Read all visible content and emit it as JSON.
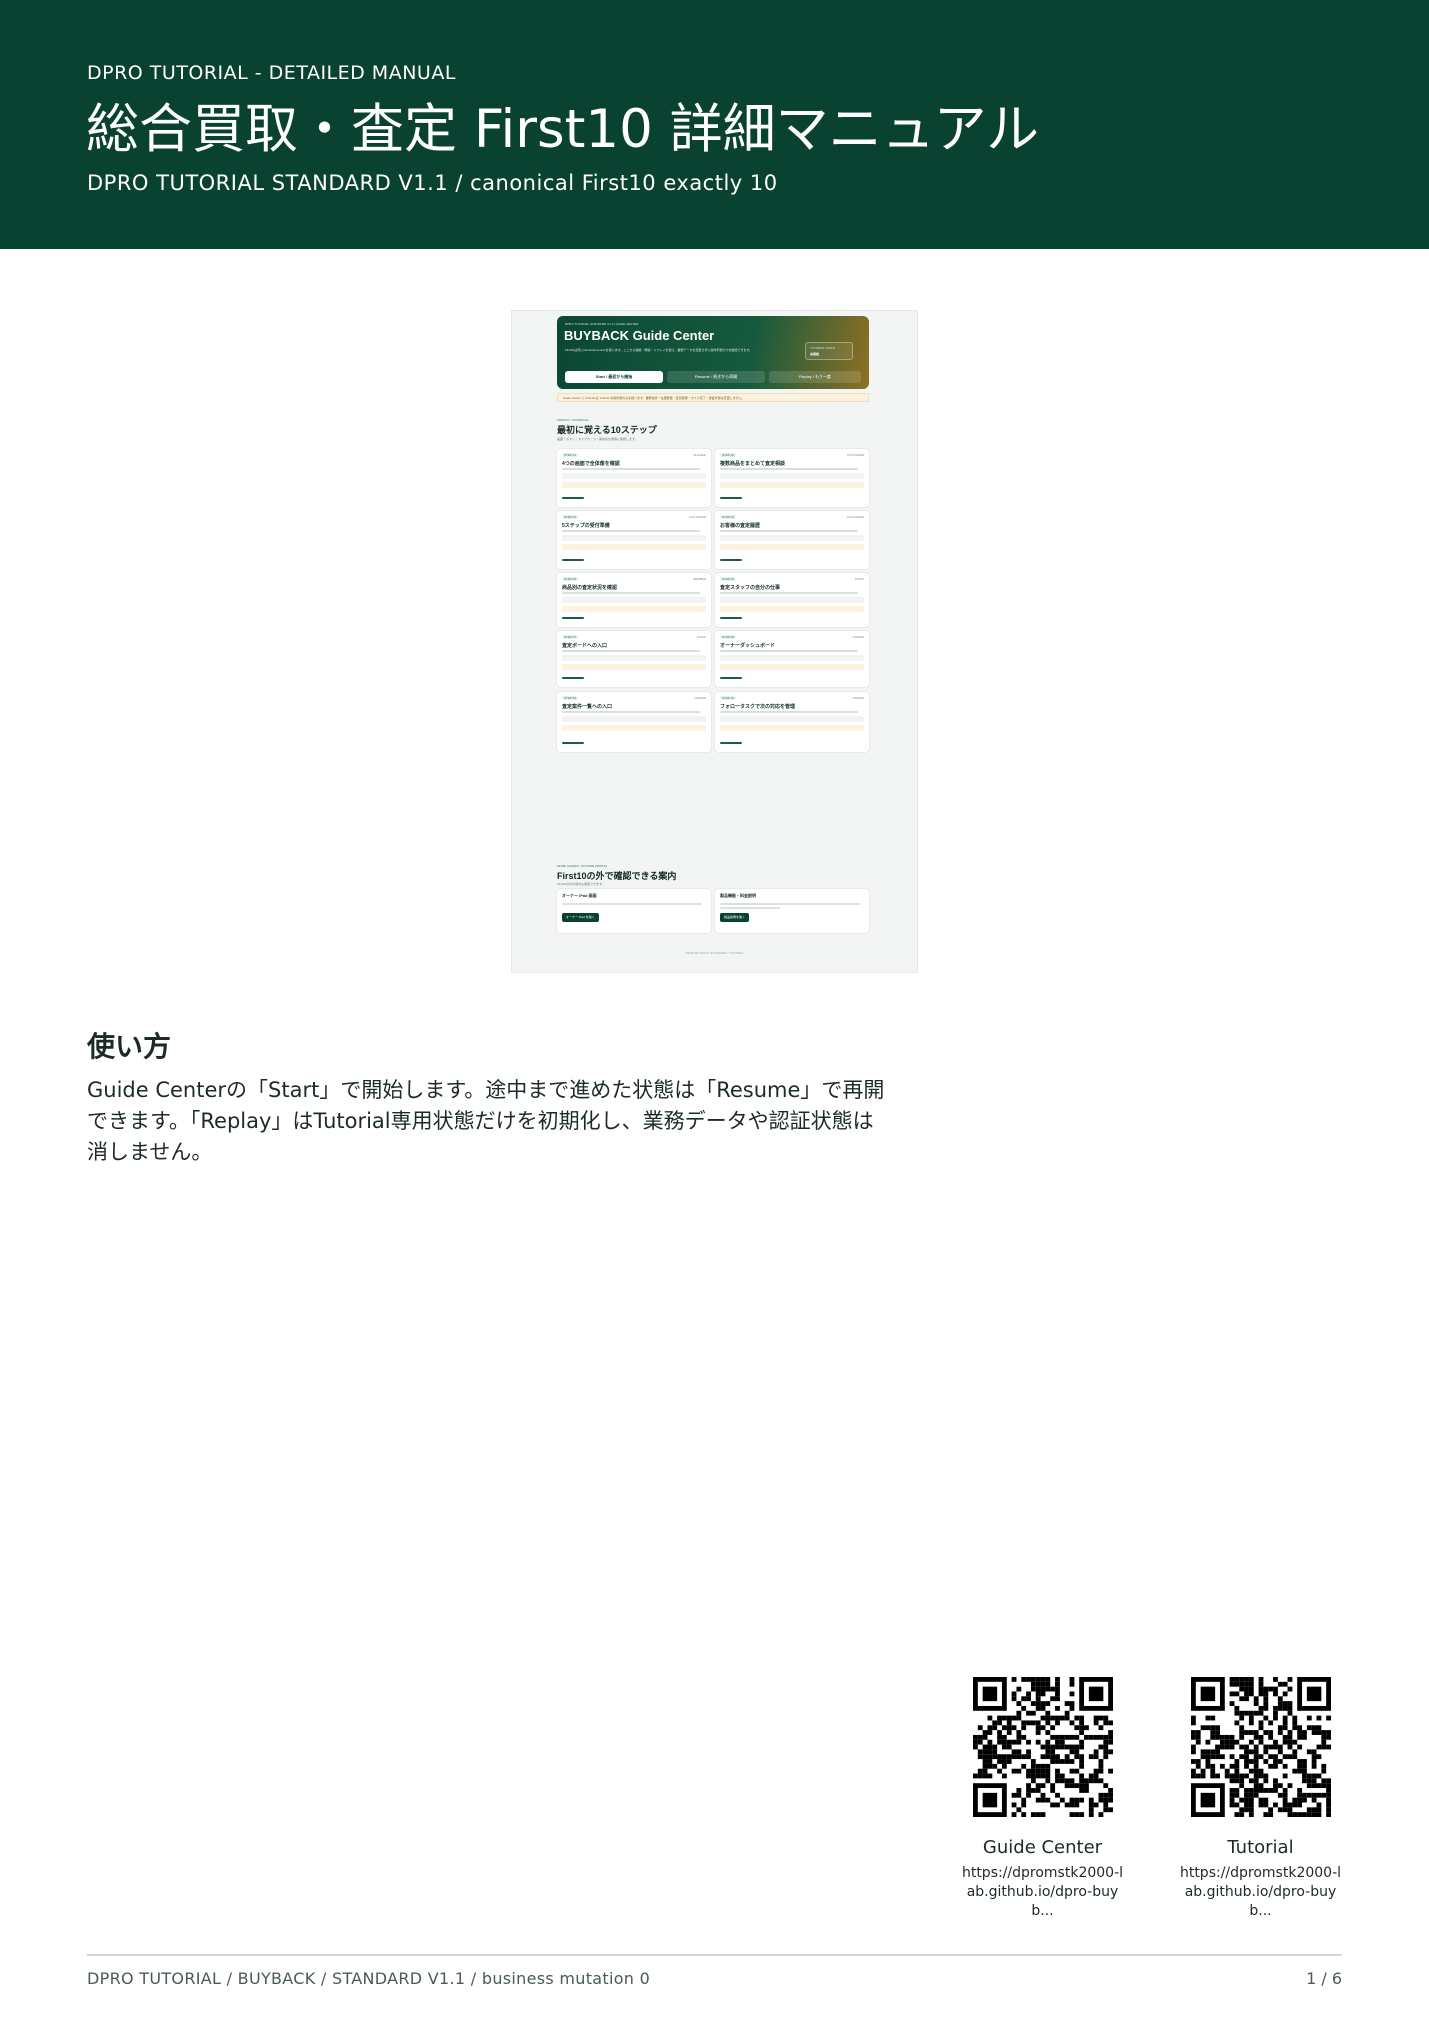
{
  "header": {
    "kicker": "DPRO TUTORIAL - DETAILED MANUAL",
    "title": "総合買取・査定 First10 詳細マニュアル",
    "subtitle": "DPRO TUTORIAL STANDARD V1.1 / canonical First10 exactly 10"
  },
  "screenshot": {
    "eyebrow": "DPRO TUTORIAL STANDARD V1.1 | GUIDE CENTER",
    "app_title": "BUYBACK Guide Center",
    "description": "First10は同じcanonical sourceを使います。ここから開始・再開・リプレイを選び、業務データを変更せずに操作手順だけを確認できます。",
    "status_label": "TUTORIAL STATE",
    "status_value": "未開始",
    "buttons": {
      "start": "Start / 最初から開始",
      "resume": "Resume / 続きから再開",
      "replay": "Replay / もう一度"
    },
    "notice": "Guide Center と First10 は Tutorial 専用状態のみを扱います。業務案件・在庫数量・査定結果・タスク完了・認証状態は変更しません。",
    "steps_eyebrow": "FIRST10 / CANONICAL",
    "steps_title": "最初に覚える10ステップ",
    "steps_sub": "画面・ボタン・タスクカード・異常系を順番に確認します。",
    "steps": [
      {
        "tag": "STEP 01",
        "role": "SHARED",
        "title": "4つの画面で全体像を確認"
      },
      {
        "tag": "STEP 02",
        "role": "CUSTOMER",
        "title": "複数商品をまとめて査定相談"
      },
      {
        "tag": "STEP 03",
        "role": "CUSTOMER",
        "title": "5ステップの受付準備"
      },
      {
        "tag": "STEP 04",
        "role": "CUSTOMER",
        "title": "お客様の査定履歴"
      },
      {
        "tag": "STEP 05",
        "role": "MEMBER",
        "title": "商品別の査定状況を確認"
      },
      {
        "tag": "STEP 06",
        "role": "STAFF",
        "title": "査定スタッフの自分の仕事"
      },
      {
        "tag": "STEP 07",
        "role": "STAFF",
        "title": "査定ボードへの入口"
      },
      {
        "tag": "STEP 08",
        "role": "OWNER",
        "title": "オーナーダッシュボード"
      },
      {
        "tag": "STEP 09",
        "role": "OWNER",
        "title": "査定案件一覧への入口"
      },
      {
        "tag": "STEP 10",
        "role": "OWNER",
        "title": "フォロータスクで次の対応を管理"
      }
    ],
    "extra_eyebrow": "MORE GUIDES / OUTSIDE FIRST10",
    "extra_title": "First10の外で確認できる案内",
    "extra_sub": "First10の外の案内も確認できます。",
    "extras": [
      {
        "title": "オーナー iPad 画面",
        "button": "オーナー iPad を開く"
      },
      {
        "title": "製品機能・料金説明",
        "button": "製品説明を開く"
      }
    ],
    "footer": "DPRO BUYBACK STANDARD / TUTORIAL"
  },
  "howto": {
    "heading": "使い方",
    "body": "Guide Centerの「Start」で開始します。途中まで進めた状態は「Resume」で再開できます。「Replay」はTutorial専用状態だけを初期化し、業務データや認証状態は消しません。"
  },
  "qr_codes": [
    {
      "label": "Guide Center",
      "url": "https://dpromstk2000-lab.github.io/dpro-buyb..."
    },
    {
      "label": "Tutorial",
      "url": "https://dpromstk2000-lab.github.io/dpro-buyb..."
    }
  ],
  "footer": {
    "left": "DPRO TUTORIAL / BUYBACK / STANDARD V1.1 / business mutation 0",
    "page": "1 / 6"
  },
  "colors": {
    "header_bg": "#0a4232",
    "accent_green": "#2d7a57",
    "notice_bg": "#fcf3df"
  }
}
